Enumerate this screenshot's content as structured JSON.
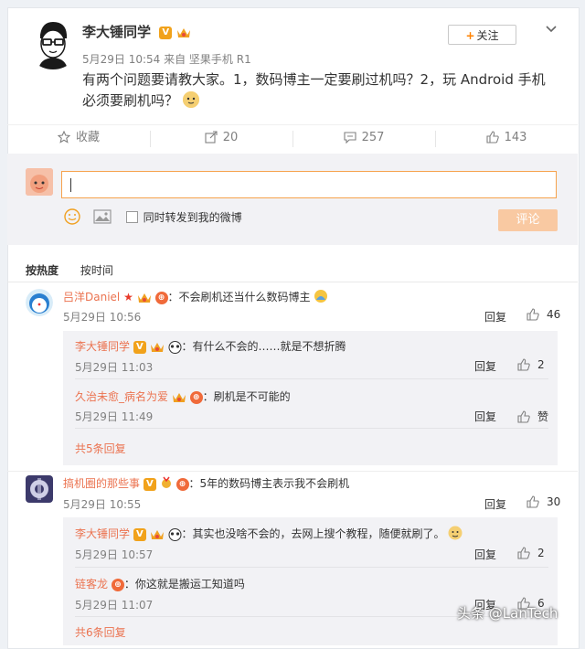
{
  "post": {
    "author": "李大锤同学",
    "badge_v": "V",
    "meta": "5月29日 10:54 来自 坚果手机 R1",
    "text": "有两个问题要请教大家。1，数码博主一定要刷过机吗？2，玩 Android 手机必须要刷机吗？",
    "follow_label": "关注"
  },
  "actions": {
    "favorite": "收藏",
    "forward": "20",
    "comment": "257",
    "like": "143"
  },
  "composer": {
    "sync_label": "同时转发到我的微博",
    "submit_label": "评论"
  },
  "sort": {
    "hot": "按热度",
    "time": "按时间"
  },
  "comments": [
    {
      "user": "吕洋Daniel",
      "text": "：不会刷机还当什么数码博主",
      "time": "5月29日 10:56",
      "reply_label": "回复",
      "likes": "46",
      "replies": [
        {
          "user": "李大锤同学",
          "text": "：有什么不会的……就是不想折腾",
          "time": "5月29日 11:03",
          "reply_label": "回复",
          "likes": "2"
        },
        {
          "user": "久治未愈_病名为爱",
          "text": "：刷机是不可能的",
          "time": "5月29日 11:49",
          "reply_label": "回复",
          "likes": "赞"
        }
      ],
      "more": "共5条回复"
    },
    {
      "user": "搞机圈的那些事",
      "text": "：5年的数码博主表示我不会刷机",
      "time": "5月29日 10:55",
      "reply_label": "回复",
      "likes": "30",
      "replies": [
        {
          "user": "李大锤同学",
          "text": "：其实也没啥不会的，去网上搜个教程，随便就刷了。",
          "time": "5月29日 10:57",
          "reply_label": "回复",
          "likes": "2"
        },
        {
          "user": "链客龙",
          "text": "：你这就是搬运工知道吗",
          "time": "5月29日 11:07",
          "reply_label": "回复",
          "likes": "6"
        }
      ],
      "more": "共6条回复"
    }
  ],
  "watermark": "头条 @LanTech"
}
